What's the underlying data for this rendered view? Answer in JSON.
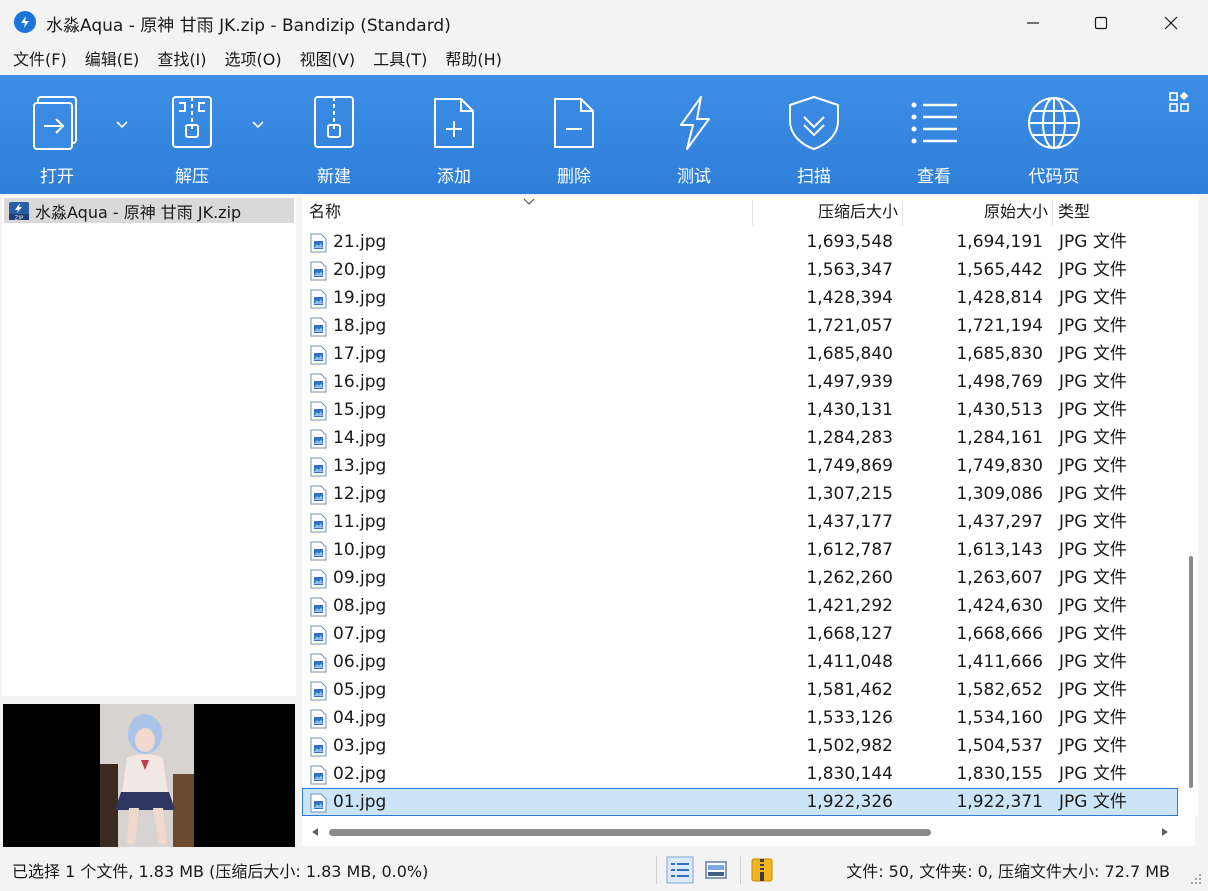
{
  "window": {
    "title": "水淼Aqua - 原神 甘雨 JK.zip - Bandizip (Standard)"
  },
  "menu": [
    "文件(F)",
    "编辑(E)",
    "查找(I)",
    "选项(O)",
    "视图(V)",
    "工具(T)",
    "帮助(H)"
  ],
  "toolbar": {
    "open": "打开",
    "extract": "解压",
    "new": "新建",
    "add": "添加",
    "delete": "删除",
    "test": "测试",
    "scan": "扫描",
    "view": "查看",
    "codepage": "代码页"
  },
  "tree": {
    "archive_name": "水淼Aqua - 原神 甘雨 JK.zip"
  },
  "columns": {
    "name": "名称",
    "compressed": "压缩后大小",
    "original": "原始大小",
    "type": "类型"
  },
  "files": [
    {
      "name": "21.jpg",
      "compressed": "1,693,548",
      "original": "1,694,191",
      "type": "JPG 文件"
    },
    {
      "name": "20.jpg",
      "compressed": "1,563,347",
      "original": "1,565,442",
      "type": "JPG 文件"
    },
    {
      "name": "19.jpg",
      "compressed": "1,428,394",
      "original": "1,428,814",
      "type": "JPG 文件"
    },
    {
      "name": "18.jpg",
      "compressed": "1,721,057",
      "original": "1,721,194",
      "type": "JPG 文件"
    },
    {
      "name": "17.jpg",
      "compressed": "1,685,840",
      "original": "1,685,830",
      "type": "JPG 文件"
    },
    {
      "name": "16.jpg",
      "compressed": "1,497,939",
      "original": "1,498,769",
      "type": "JPG 文件"
    },
    {
      "name": "15.jpg",
      "compressed": "1,430,131",
      "original": "1,430,513",
      "type": "JPG 文件"
    },
    {
      "name": "14.jpg",
      "compressed": "1,284,283",
      "original": "1,284,161",
      "type": "JPG 文件"
    },
    {
      "name": "13.jpg",
      "compressed": "1,749,869",
      "original": "1,749,830",
      "type": "JPG 文件"
    },
    {
      "name": "12.jpg",
      "compressed": "1,307,215",
      "original": "1,309,086",
      "type": "JPG 文件"
    },
    {
      "name": "11.jpg",
      "compressed": "1,437,177",
      "original": "1,437,297",
      "type": "JPG 文件"
    },
    {
      "name": "10.jpg",
      "compressed": "1,612,787",
      "original": "1,613,143",
      "type": "JPG 文件"
    },
    {
      "name": "09.jpg",
      "compressed": "1,262,260",
      "original": "1,263,607",
      "type": "JPG 文件"
    },
    {
      "name": "08.jpg",
      "compressed": "1,421,292",
      "original": "1,424,630",
      "type": "JPG 文件"
    },
    {
      "name": "07.jpg",
      "compressed": "1,668,127",
      "original": "1,668,666",
      "type": "JPG 文件"
    },
    {
      "name": "06.jpg",
      "compressed": "1,411,048",
      "original": "1,411,666",
      "type": "JPG 文件"
    },
    {
      "name": "05.jpg",
      "compressed": "1,581,462",
      "original": "1,582,652",
      "type": "JPG 文件"
    },
    {
      "name": "04.jpg",
      "compressed": "1,533,126",
      "original": "1,534,160",
      "type": "JPG 文件"
    },
    {
      "name": "03.jpg",
      "compressed": "1,502,982",
      "original": "1,504,537",
      "type": "JPG 文件"
    },
    {
      "name": "02.jpg",
      "compressed": "1,830,144",
      "original": "1,830,155",
      "type": "JPG 文件"
    },
    {
      "name": "01.jpg",
      "compressed": "1,922,326",
      "original": "1,922,371",
      "type": "JPG 文件",
      "selected": true
    }
  ],
  "status": {
    "selection": "已选择 1 个文件, 1.83 MB (压缩后大小: 1.83 MB, 0.0%)",
    "summary": "文件: 50, 文件夹: 0, 压缩文件大小: 72.7 MB"
  },
  "icons": {
    "app": "bandizip-icon",
    "open": "open-archive-icon",
    "extract": "extract-zip-icon",
    "new": "new-archive-icon",
    "add": "add-file-icon",
    "delete": "delete-file-icon",
    "test": "lightning-icon",
    "scan": "shield-icon",
    "view": "list-icon",
    "codepage": "globe-icon",
    "file": "jpg-file-icon"
  },
  "colors": {
    "toolbar": "#3088e0",
    "selection": "#cce4f7",
    "selection_border": "#3079d6"
  }
}
